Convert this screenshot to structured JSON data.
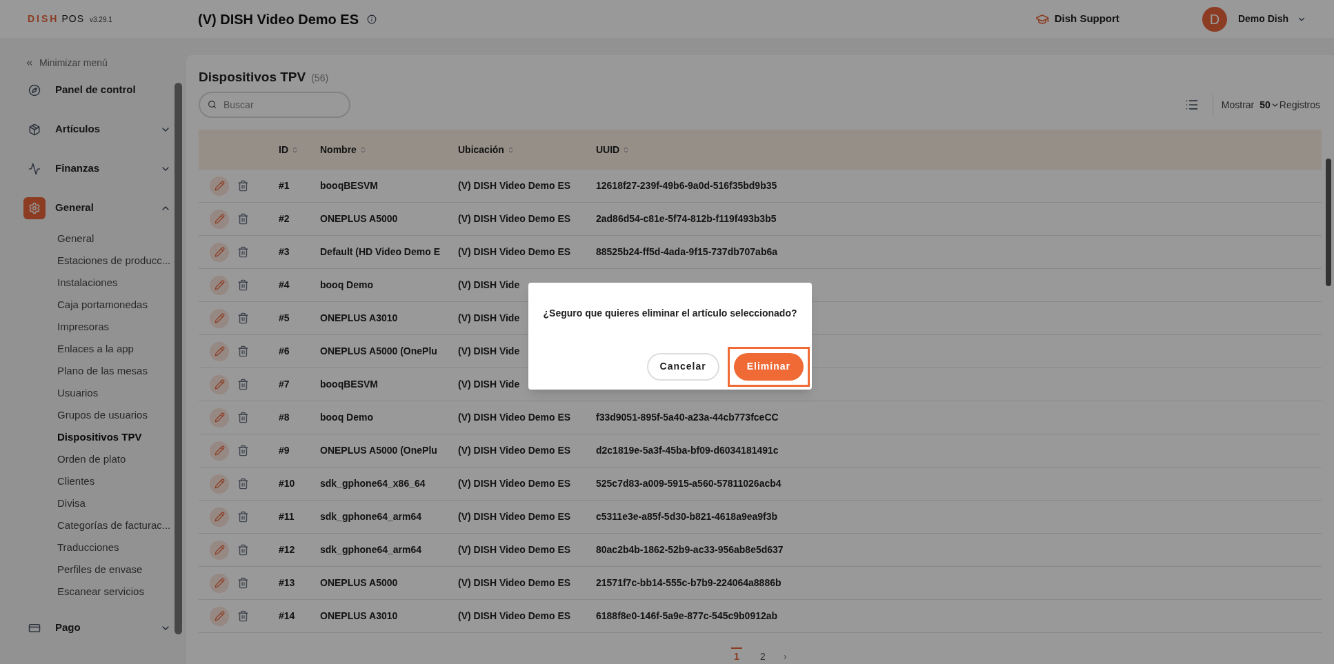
{
  "header": {
    "logo_main": "DISH",
    "logo_sub": "POS",
    "version": "v3.29.1",
    "venue": "(V) DISH Video Demo ES",
    "support": "Dish Support",
    "avatar": "D",
    "user": "Demo Dish"
  },
  "sidebar": {
    "collapse": "Minimizar menú",
    "items": [
      {
        "label": "Panel de control",
        "selected": false
      },
      {
        "label": "Artículos",
        "selected": false,
        "expanded": false
      },
      {
        "label": "Finanzas",
        "selected": false,
        "expanded": false
      },
      {
        "label": "General",
        "selected": true,
        "expanded": true,
        "children": [
          {
            "label": "General",
            "selected": false
          },
          {
            "label": "Estaciones de producc...",
            "selected": false
          },
          {
            "label": "Instalaciones",
            "selected": false
          },
          {
            "label": "Caja portamonedas",
            "selected": false
          },
          {
            "label": "Impresoras",
            "selected": false
          },
          {
            "label": "Enlaces a la app",
            "selected": false
          },
          {
            "label": "Plano de las mesas",
            "selected": false
          },
          {
            "label": "Usuarios",
            "selected": false
          },
          {
            "label": "Grupos de usuarios",
            "selected": false
          },
          {
            "label": "Dispositivos TPV",
            "selected": true
          },
          {
            "label": "Orden de plato",
            "selected": false
          },
          {
            "label": "Clientes",
            "selected": false
          },
          {
            "label": "Divisa",
            "selected": false
          },
          {
            "label": "Categorías de facturac...",
            "selected": false
          },
          {
            "label": "Traducciones",
            "selected": false
          },
          {
            "label": "Perfiles de envase",
            "selected": false
          },
          {
            "label": "Escanear servicios",
            "selected": false
          }
        ]
      },
      {
        "label": "Pago",
        "selected": false,
        "expanded": false
      }
    ]
  },
  "page": {
    "title": "Dispositivos TPV",
    "count": "(56)",
    "search": {
      "placeholder": "Buscar"
    },
    "show_label": "Mostrar",
    "page_size": "50",
    "records_label": "Registros"
  },
  "table": {
    "columns": [
      "ID",
      "Nombre",
      "Ubicación",
      "UUID"
    ],
    "rows": [
      {
        "id": "#1",
        "name": "booqBESVM",
        "location": "(V) DISH Video Demo ES",
        "uuid": "12618f27-239f-49b6-9a0d-516f35bd9b35"
      },
      {
        "id": "#2",
        "name": "ONEPLUS A5000",
        "location": "(V) DISH Video Demo ES",
        "uuid": "2ad86d54-c81e-5f74-812b-f119f493b3b5"
      },
      {
        "id": "#3",
        "name": "Default (HD Video Demo E",
        "location": "(V) DISH Video Demo ES",
        "uuid": "88525b24-ff5d-4ada-9f15-737db707ab6a"
      },
      {
        "id": "#4",
        "name": "booq Demo",
        "location": "(V) DISH Vide"
      },
      {
        "id": "#5",
        "name": "ONEPLUS A3010",
        "location": "(V) DISH Vide"
      },
      {
        "id": "#6",
        "name": "ONEPLUS A5000 (OnePlu",
        "location": "(V) DISH Vide"
      },
      {
        "id": "#7",
        "name": "booqBESVM",
        "location": "(V) DISH Vide"
      },
      {
        "id": "#8",
        "name": "booq Demo",
        "location": "(V) DISH Video Demo ES",
        "uuid": "f33d9051-895f-5a40-a23a-44cb773fceCC"
      },
      {
        "id": "#9",
        "name": "ONEPLUS A5000 (OnePlu",
        "location": "(V) DISH Video Demo ES",
        "uuid": "d2c1819e-5a3f-45ba-bf09-d6034181491c"
      },
      {
        "id": "#10",
        "name": "sdk_gphone64_x86_64",
        "location": "(V) DISH Video Demo ES",
        "uuid": "525c7d83-a009-5915-a560-57811026acb4"
      },
      {
        "id": "#11",
        "name": "sdk_gphone64_arm64",
        "location": "(V) DISH Video Demo ES",
        "uuid": "c5311e3e-a85f-5d30-b821-4618a9ea9f3b"
      },
      {
        "id": "#12",
        "name": "sdk_gphone64_arm64",
        "location": "(V) DISH Video Demo ES",
        "uuid": "80ac2b4b-1862-52b9-ac33-956ab8e5d637"
      },
      {
        "id": "#13",
        "name": "ONEPLUS A5000",
        "location": "(V) DISH Video Demo ES",
        "uuid": "21571f7c-bb14-555c-b7b9-224064a8886b"
      },
      {
        "id": "#14",
        "name": "ONEPLUS A3010",
        "location": "(V) DISH Video Demo ES",
        "uuid": "6188f8e0-146f-5a9e-877c-545c9b0912ab"
      }
    ]
  },
  "pagination": {
    "pages": [
      {
        "label": "1",
        "selected": true
      },
      {
        "label": "2",
        "selected": false
      }
    ],
    "next": "›"
  },
  "dialog": {
    "message": "¿Seguro que quieres eliminar el artículo seleccionado?",
    "cancel": "Cancelar",
    "confirm": "Eliminar",
    "confirm_highlighted": true
  }
}
